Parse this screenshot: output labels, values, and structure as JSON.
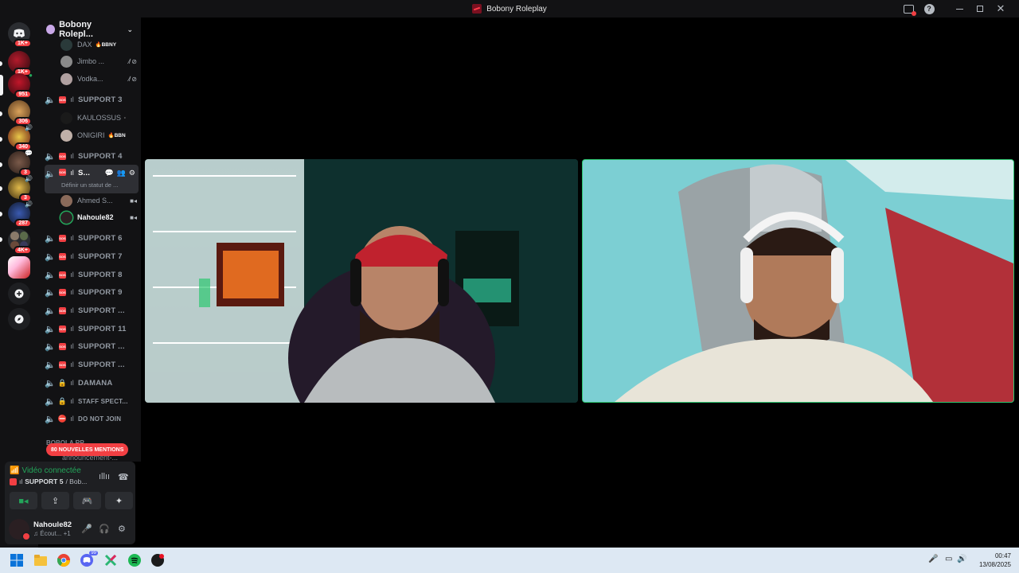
{
  "window": {
    "title": "Bobony Roleplay"
  },
  "rail": {
    "servers": [
      {
        "badge": "1K+"
      },
      {
        "badge": "1K+"
      },
      {
        "badge": "951"
      },
      {
        "badge": "306"
      },
      {
        "badge": "340"
      },
      {
        "badge": "3"
      },
      {
        "badge": "3"
      },
      {
        "badge": "287"
      },
      {
        "badge": "4K+"
      },
      {
        "badge": ""
      }
    ]
  },
  "sidebar": {
    "guild_name": "Bobony Rolepl...",
    "users_top": [
      {
        "name": "DAX",
        "tag": "🔥BBNY"
      },
      {
        "name": "Jimbo ...",
        "tag": ""
      },
      {
        "name": "Vodka...",
        "tag": ""
      }
    ],
    "channels": [
      {
        "label": "SUPPORT 3"
      },
      {
        "label": "SUPPORT 4"
      },
      {
        "label": "S...",
        "sub": "Définir un statut de ..."
      },
      {
        "label": "SUPPORT 6"
      },
      {
        "label": "SUPPORT 7"
      },
      {
        "label": "SUPPORT 8"
      },
      {
        "label": "SUPPORT 9"
      },
      {
        "label": "SUPPORT ..."
      },
      {
        "label": "SUPPORT 11"
      },
      {
        "label": "SUPPORT ..."
      },
      {
        "label": "SUPPORT ..."
      },
      {
        "label": "DAMANA"
      },
      {
        "label": "STAFF SPECT..."
      },
      {
        "label": "DO NOT JOIN"
      }
    ],
    "support3_users": [
      {
        "name": "KAULOSSUS",
        "tag": "·"
      },
      {
        "name": "ONIGIRI",
        "tag": "🔥BBN"
      }
    ],
    "support5_users": [
      {
        "name": "Ahmed S..."
      },
      {
        "name": "Nahoule82"
      }
    ],
    "category": "BOBOLA RP",
    "category_channel": "announcement-...",
    "mentions": "80 NOUVELLES MENTIONS"
  },
  "voice": {
    "status": "Vidéo connectée",
    "channel": "SUPPORT 5",
    "server": " / Bob..."
  },
  "user": {
    "name": "Nahoule82",
    "status": "Écout...",
    "extra": "+1"
  },
  "taskbar": {
    "time": "00:47",
    "date": "13/08/2025",
    "discord_badge": "99"
  },
  "colors": {
    "accent_green": "#23a55a",
    "mention_red": "#f23f43",
    "bg": "#121214"
  }
}
